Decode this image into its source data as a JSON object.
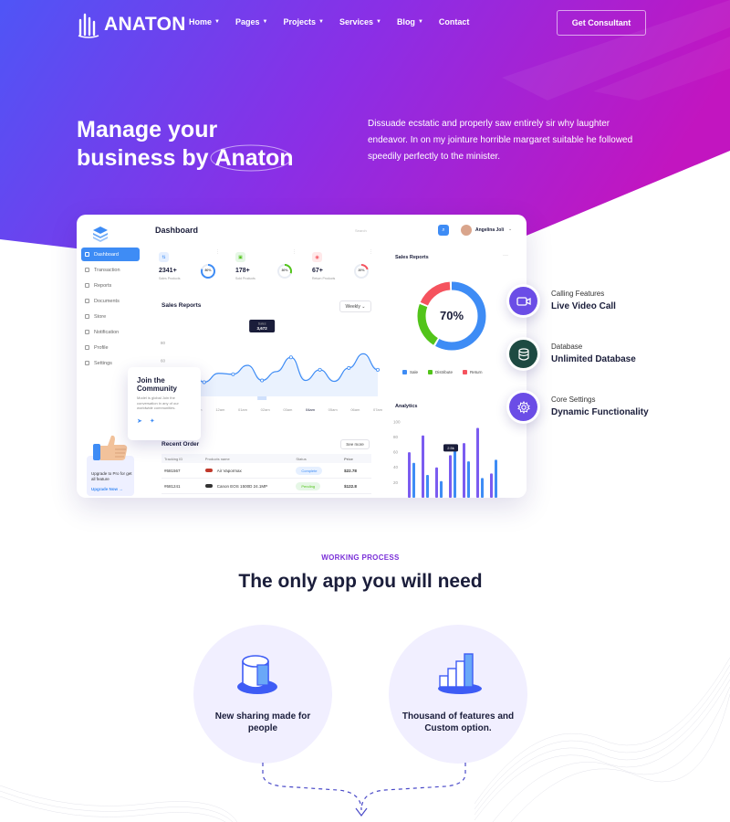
{
  "nav": {
    "brand": "ANATON",
    "menu": [
      {
        "label": "Home",
        "has_dropdown": true
      },
      {
        "label": "Pages",
        "has_dropdown": true
      },
      {
        "label": "Projects",
        "has_dropdown": true
      },
      {
        "label": "Services",
        "has_dropdown": true
      },
      {
        "label": "Blog",
        "has_dropdown": true
      },
      {
        "label": "Contact",
        "has_dropdown": false
      }
    ],
    "cta": "Get Consultant"
  },
  "hero": {
    "title_line1": "Manage your",
    "title_line2_prefix": "business by ",
    "title_brand": "Anaton",
    "description": "Dissuade ecstatic and properly saw entirely sir why laughter endeavor. In on my jointure horrible margaret suitable he followed speedily perfectly to the minister."
  },
  "dashboard": {
    "title": "Dashboard",
    "search_placeholder": "Search",
    "user_name": "Angelina Joli",
    "sidebar": [
      {
        "label": "Dashboard",
        "active": true
      },
      {
        "label": "Transaction",
        "active": false
      },
      {
        "label": "Reports",
        "active": false
      },
      {
        "label": "Documents",
        "active": false
      },
      {
        "label": "Store",
        "active": false
      },
      {
        "label": "Notification",
        "active": false
      },
      {
        "label": "Profile",
        "active": false
      },
      {
        "label": "Settings",
        "active": false
      }
    ],
    "upgrade_text": "Upgrade to Pro for get all feature",
    "upgrade_link": "Upgrade Now",
    "join_card": {
      "title": "Join the Community",
      "text": "Model is global Join the conversation in any of our worldwide communities."
    },
    "stats": [
      {
        "value": "2341+",
        "label": "Sales Products",
        "percent_label": "80%",
        "percent": 80,
        "color": "#3e8cf5",
        "icon_color": "#e5efff",
        "icon": "chart-icon"
      },
      {
        "value": "178+",
        "label": "Sold Products",
        "percent_label": "30%",
        "percent": 30,
        "color": "#52c41a",
        "icon_color": "#e6f7e6",
        "icon": "box-icon"
      },
      {
        "value": "67+",
        "label": "Return Products",
        "percent_label": "20%",
        "percent": 20,
        "color": "#f5535e",
        "icon_color": "#ffe9ea",
        "icon": "return-icon"
      }
    ],
    "sales_reports": {
      "title": "Sales Reports",
      "period": "Weekly",
      "tooltip_label": "Sales",
      "tooltip_value": "3,672"
    },
    "recent_order": {
      "title": "Recent Order",
      "see_more": "See more",
      "headers": [
        "Tracking ID",
        "Products name",
        "Status",
        "Price"
      ],
      "rows": [
        {
          "id": "#681567",
          "product": "Air Vapormax",
          "status": "Complete",
          "price": "$22.78"
        },
        {
          "id": "#681241",
          "product": "Canon EOS 1500D 24.1MP",
          "status": "Pending",
          "price": "$122.8"
        }
      ]
    },
    "right_panel": {
      "title": "Sales Reports",
      "donut_label": "70%",
      "donut_percent": 70,
      "legend": [
        {
          "label": "Sale",
          "color": "#3e8cf5"
        },
        {
          "label": "Distribute",
          "color": "#52c41a"
        },
        {
          "label": "Return",
          "color": "#f5535e"
        }
      ],
      "analytics_title": "Analytics",
      "analytics_tooltip": "2.5k"
    }
  },
  "chart_data": [
    {
      "type": "line",
      "title": "Sales Reports",
      "x": [
        "10am",
        "11am",
        "12am",
        "01am",
        "02am",
        "03am",
        "04am",
        "05am",
        "06am",
        "07am"
      ],
      "y_ticks": [
        "80",
        "60",
        "40"
      ],
      "values": [
        42,
        52,
        36,
        46,
        45,
        55,
        38,
        48,
        64,
        38,
        50,
        37,
        52,
        68,
        50
      ],
      "highlight_index": 6
    },
    {
      "type": "bar",
      "title": "Analytics",
      "y_ticks": [
        "100",
        "80",
        "60",
        "40",
        "20"
      ],
      "series": [
        {
          "color": "#7b5cf0",
          "values": [
            60,
            82,
            40,
            56,
            72,
            92,
            32
          ]
        },
        {
          "color": "#3e8cf5",
          "values": [
            46,
            30,
            22,
            66,
            48,
            26,
            50
          ]
        }
      ]
    }
  ],
  "features": [
    {
      "label": "Calling Features",
      "value": "Live Video Call",
      "icon": "video-icon",
      "color": "#6b4de6"
    },
    {
      "label": "Database",
      "value": "Unlimited Database",
      "icon": "database-icon",
      "color": "#1e4a42"
    },
    {
      "label": "Core Settings",
      "value": "Dynamic Functionality",
      "icon": "gear-icon",
      "color": "#6b4de6"
    }
  ],
  "working_process": {
    "label": "WORKING PROCESS",
    "title": "The only app you will need",
    "items": [
      {
        "text": "New sharing made for people",
        "icon": "cylinder-icon"
      },
      {
        "text": "Thousand of features and Custom option.",
        "icon": "blocks-icon"
      }
    ]
  },
  "colors": {
    "hero_start": "#5b4cf5",
    "hero_end": "#c119c2",
    "accent": "#3e8cf5",
    "heading": "#1a1d3a"
  }
}
